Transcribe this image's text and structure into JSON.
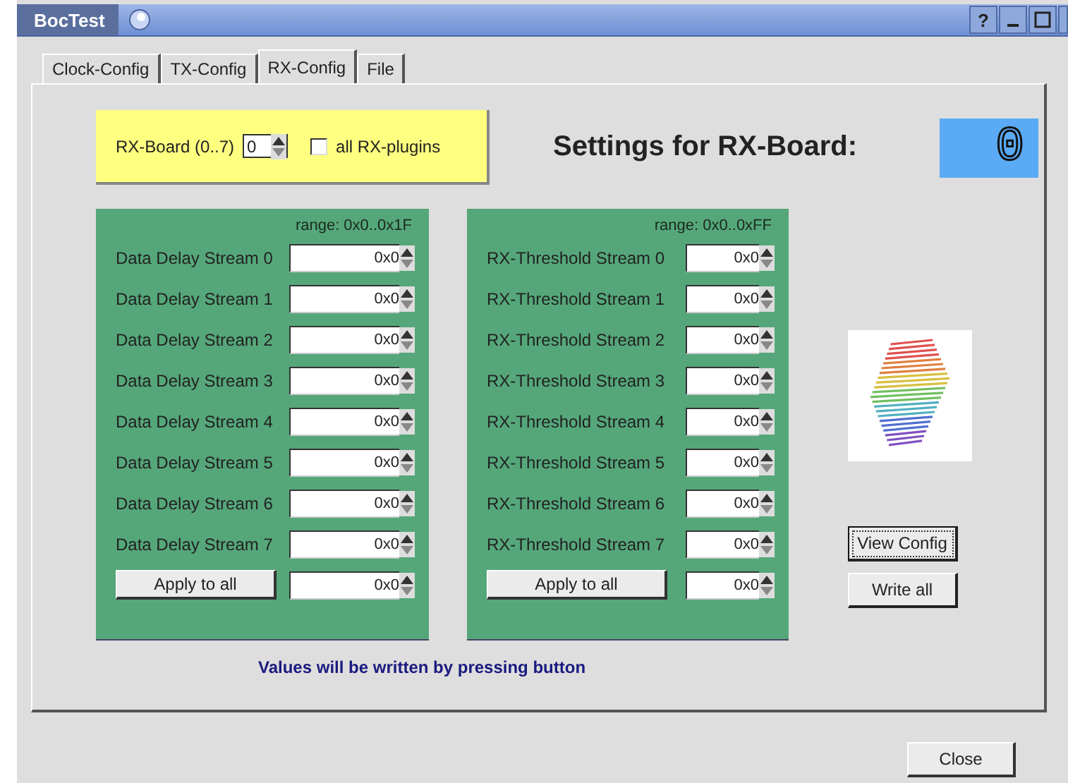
{
  "window": {
    "title": "BocTest",
    "help": "?"
  },
  "tabs": [
    {
      "label": "Clock-Config",
      "selected": false
    },
    {
      "label": "TX-Config",
      "selected": false
    },
    {
      "label": "RX-Config",
      "selected": true
    },
    {
      "label": "File",
      "selected": false
    }
  ],
  "board": {
    "label": "RX-Board (0..7)",
    "value": "0",
    "all_plugins": {
      "label": "all RX-plugins",
      "checked": false
    }
  },
  "heading": "Settings for RX-Board:",
  "display": "0",
  "panels": [
    {
      "range": "range: 0x0..0x1F",
      "rows": [
        {
          "label": "Data Delay Stream 0",
          "value": "0x0"
        },
        {
          "label": "Data Delay Stream 1",
          "value": "0x0"
        },
        {
          "label": "Data Delay Stream 2",
          "value": "0x0"
        },
        {
          "label": "Data Delay Stream 3",
          "value": "0x0"
        },
        {
          "label": "Data Delay Stream 4",
          "value": "0x0"
        },
        {
          "label": "Data Delay Stream 5",
          "value": "0x0"
        },
        {
          "label": "Data Delay Stream 6",
          "value": "0x0"
        },
        {
          "label": "Data Delay Stream 7",
          "value": "0x0"
        }
      ],
      "apply": {
        "label": "Apply to all",
        "value": "0x0"
      }
    },
    {
      "range": "range: 0x0..0xFF",
      "rows": [
        {
          "label": "RX-Threshold Stream 0",
          "value": "0x0"
        },
        {
          "label": "RX-Threshold Stream 1",
          "value": "0x0"
        },
        {
          "label": "RX-Threshold Stream 2",
          "value": "0x0"
        },
        {
          "label": "RX-Threshold Stream 3",
          "value": "0x0"
        },
        {
          "label": "RX-Threshold Stream 4",
          "value": "0x0"
        },
        {
          "label": "RX-Threshold Stream 5",
          "value": "0x0"
        },
        {
          "label": "RX-Threshold Stream 6",
          "value": "0x0"
        },
        {
          "label": "RX-Threshold Stream 7",
          "value": "0x0"
        }
      ],
      "apply": {
        "label": "Apply to all",
        "value": "0x0"
      }
    }
  ],
  "note": "Values will be written by pressing button",
  "side_buttons": [
    {
      "label": "View Config",
      "focused": true
    },
    {
      "label": "Write all",
      "focused": false
    }
  ],
  "close": "Close"
}
